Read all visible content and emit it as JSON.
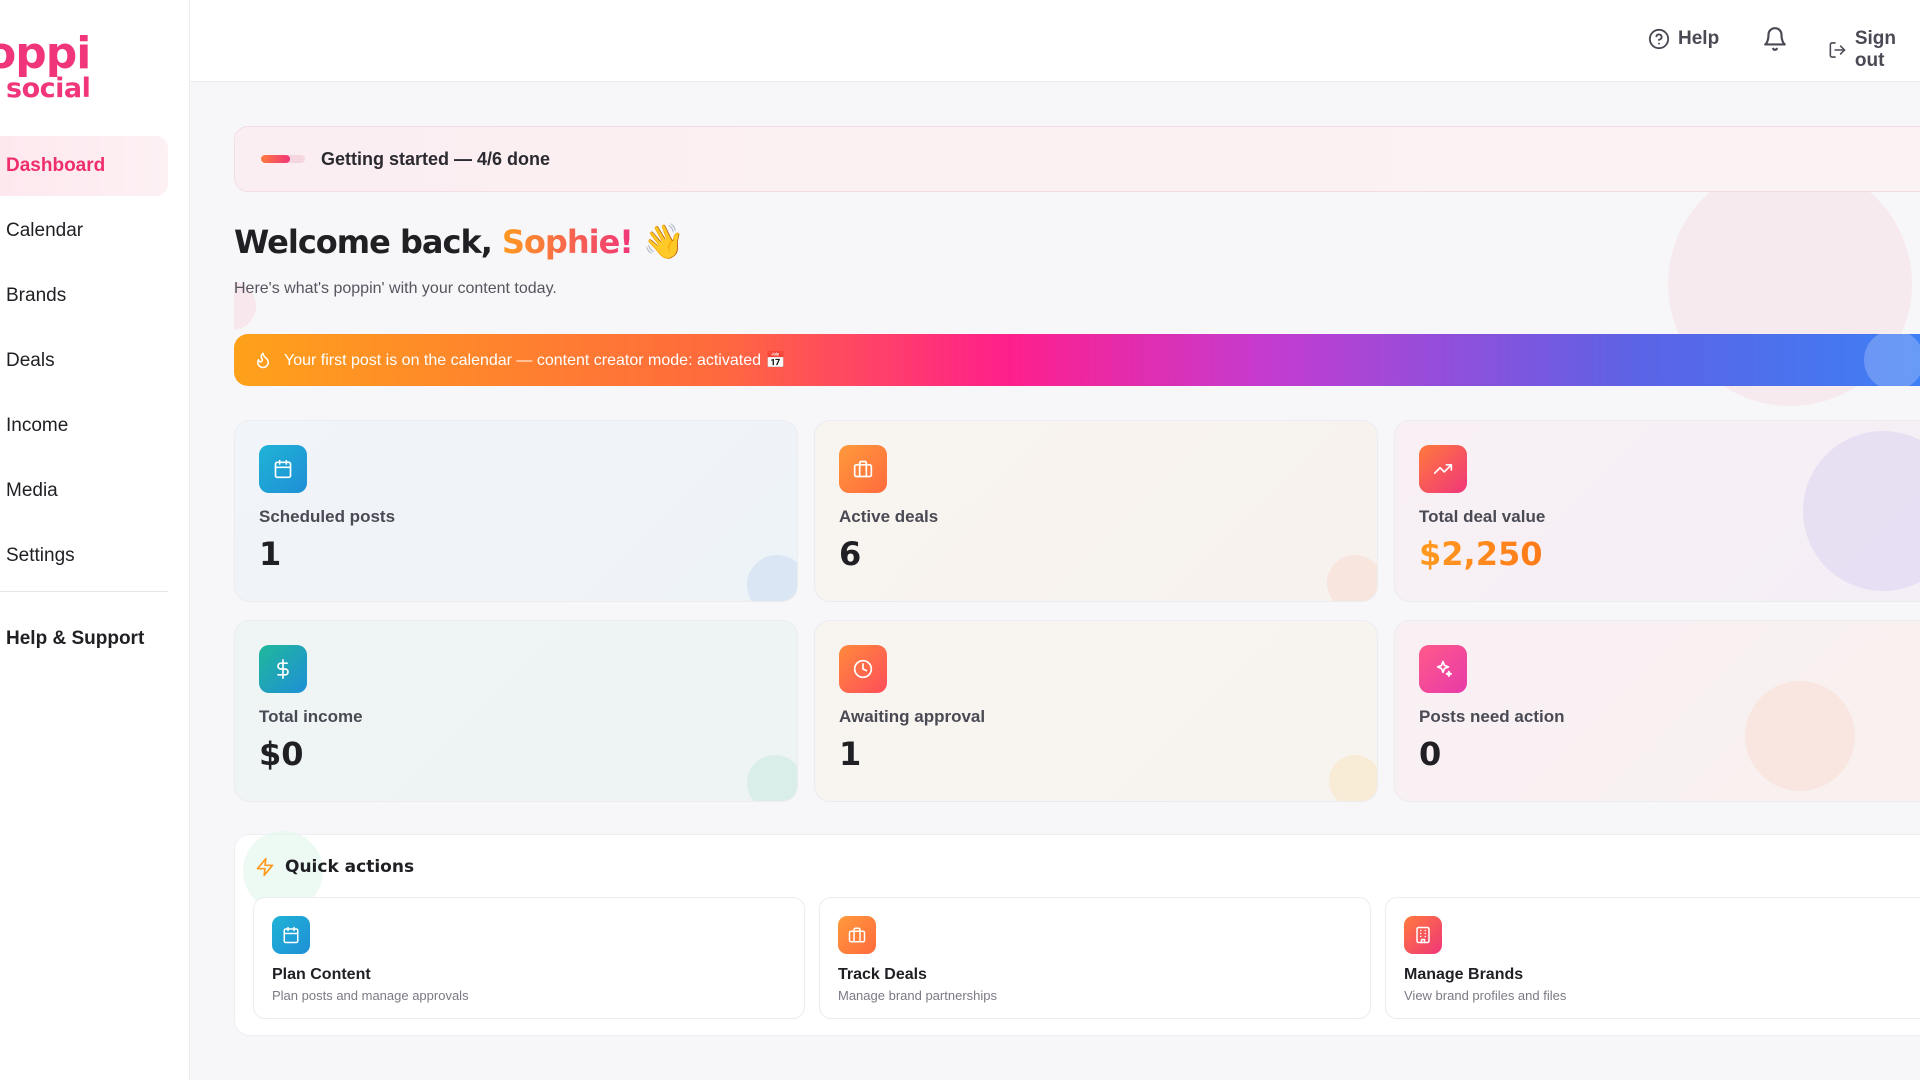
{
  "brand": {
    "logo_top": "oppi",
    "logo_bottom": "social"
  },
  "sidebar": {
    "items": [
      {
        "label": "Dashboard",
        "active": true
      },
      {
        "label": "Calendar"
      },
      {
        "label": "Brands"
      },
      {
        "label": "Deals"
      },
      {
        "label": "Income"
      },
      {
        "label": "Media"
      },
      {
        "label": "Settings"
      }
    ],
    "help_label": "Help & Support"
  },
  "topbar": {
    "help_label": "Help",
    "signout_label": "Sign out",
    "bell_icon": "bell-icon"
  },
  "getting_started": {
    "label": "Getting started — 4/6 done",
    "completed": 4,
    "total": 6
  },
  "welcome": {
    "prefix": "Welcome back,",
    "name": "Sophie!",
    "emoji": "👋",
    "subtitle": "Here's what's poppin' with your content today."
  },
  "banner": {
    "text": "Your first post is on the calendar — content creator mode: activated 📅"
  },
  "stats": [
    {
      "label": "Scheduled posts",
      "value": "1",
      "icon": "calendar-icon"
    },
    {
      "label": "Active deals",
      "value": "6",
      "icon": "briefcase-icon"
    },
    {
      "label": "Total deal value",
      "value": "$2,250",
      "icon": "trending-up-icon"
    },
    {
      "label": "Total income",
      "value": "$0",
      "icon": "dollar-icon"
    },
    {
      "label": "Awaiting approval",
      "value": "1",
      "icon": "clock-icon"
    },
    {
      "label": "Posts need action",
      "value": "0",
      "icon": "sparkles-icon"
    }
  ],
  "quick_actions": {
    "title": "Quick actions",
    "items": [
      {
        "title": "Plan Content",
        "desc": "Plan posts and manage approvals",
        "icon": "calendar-icon"
      },
      {
        "title": "Track Deals",
        "desc": "Manage brand partnerships",
        "icon": "briefcase-icon"
      },
      {
        "title": "Manage Brands",
        "desc": "View brand profiles and files",
        "icon": "building-icon"
      }
    ]
  },
  "colors": {
    "accent_pink": "#f0357a",
    "accent_orange": "#ff9a1f",
    "banner_start": "#ffa11a",
    "banner_end": "#3b82f6"
  }
}
